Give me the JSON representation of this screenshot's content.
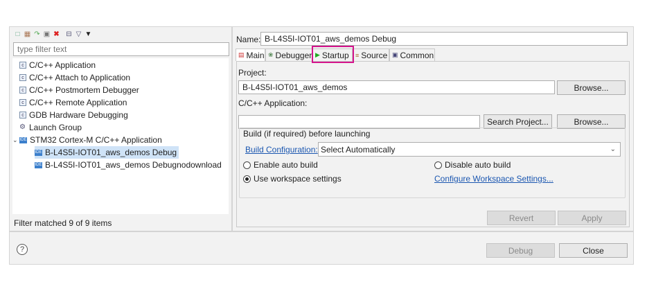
{
  "left_panel": {
    "toolbar_icons": [
      "new-config-icon",
      "duplicate-icon",
      "export-icon",
      "import-icon",
      "delete-icon",
      "collapse-all-icon",
      "filter-icon",
      "view-menu-icon"
    ],
    "filter_placeholder": "type filter text",
    "tree": [
      {
        "label": "C/C++ Application",
        "icon": "c-config-icon"
      },
      {
        "label": "C/C++ Attach to Application",
        "icon": "c-config-icon"
      },
      {
        "label": "C/C++ Postmortem Debugger",
        "icon": "c-config-icon"
      },
      {
        "label": "C/C++ Remote Application",
        "icon": "c-config-icon"
      },
      {
        "label": "GDB Hardware Debugging",
        "icon": "c-config-icon"
      },
      {
        "label": "Launch Group",
        "icon": "launch-group-icon"
      },
      {
        "label": "STM32 Cortex-M C/C++ Application",
        "icon": "stm32-icon",
        "expanded": true
      },
      {
        "label": "B-L4S5I-IOT01_aws_demos Debug",
        "icon": "stm32-config-icon",
        "selected": true
      },
      {
        "label": "B-L4S5I-IOT01_aws_demos Debugnodownload",
        "icon": "stm32-config-icon"
      }
    ],
    "filter_status": "Filter matched 9 of 9 items"
  },
  "right_panel": {
    "name_label": "Name:",
    "name_value": "B-L4S5I-IOT01_aws_demos Debug",
    "tabs": [
      {
        "label": "Main",
        "icon": "main-tab-icon",
        "active": true
      },
      {
        "label": "Debugger",
        "icon": "debugger-tab-icon"
      },
      {
        "label": "Startup",
        "icon": "startup-tab-icon",
        "highlighted": true
      },
      {
        "label": "Source",
        "icon": "source-tab-icon"
      },
      {
        "label": "Common",
        "icon": "common-tab-icon"
      }
    ],
    "project_label": "Project:",
    "project_value": "B-L4S5I-IOT01_aws_demos",
    "browse_label": "Browse...",
    "application_label": "C/C++ Application:",
    "application_value": "",
    "search_project_label": "Search Project...",
    "build_group_label": "Build (if required) before launching",
    "build_config_link": "Build Configuration:",
    "build_config_value": "Select Automatically",
    "radio_enable": "Enable auto build",
    "radio_disable": "Disable auto build",
    "radio_workspace": "Use workspace settings",
    "configure_link": "Configure Workspace Settings...",
    "revert_label": "Revert",
    "apply_label": "Apply"
  },
  "bottom": {
    "help_glyph": "?",
    "debug_label": "Debug",
    "close_label": "Close"
  },
  "colors": {
    "highlight": "#d4148c",
    "link": "#1a56b0",
    "selection": "#cfe3f7"
  }
}
